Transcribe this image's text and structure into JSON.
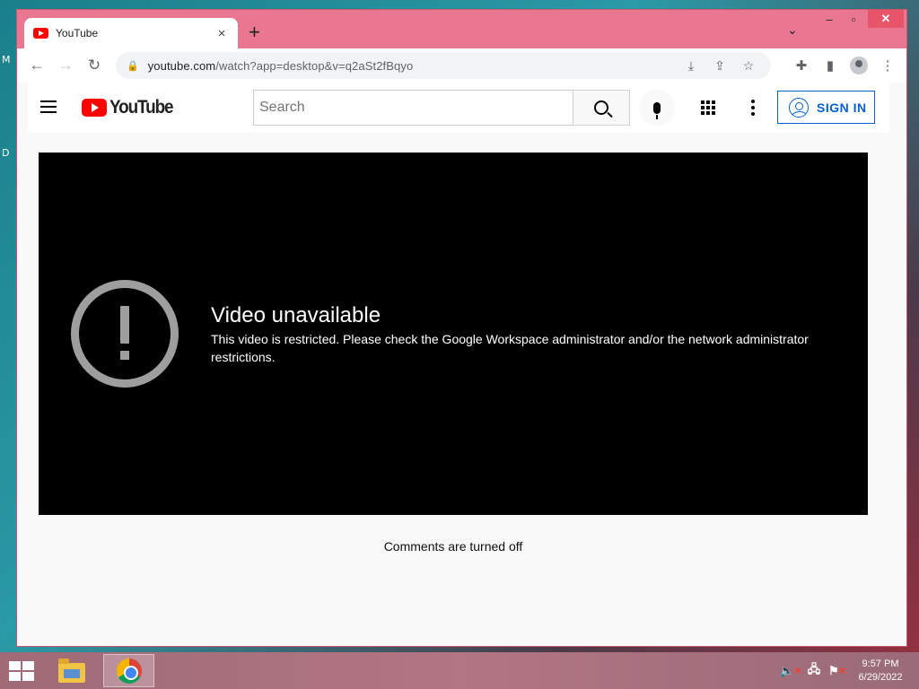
{
  "desktop": {
    "edge_letter_1": "M",
    "edge_letter_2": "D"
  },
  "browser": {
    "tab": {
      "title": "YouTube",
      "close": "×"
    },
    "new_tab": "+",
    "tab_search": "⌄",
    "window_controls": {
      "minimize": "–",
      "maximize": "▫",
      "close": "✕"
    },
    "toolbar": {
      "back": "←",
      "forward": "→",
      "reload": "↻",
      "url_host": "youtube.com",
      "url_path": "/watch?app=desktop&v=q2aSt2fBqyo",
      "install_icon": "⤓",
      "share_icon": "⇪",
      "star_icon": "☆",
      "extensions_icon": "✚",
      "sidepanel_icon": "▮",
      "menu_icon": "⋮"
    }
  },
  "youtube": {
    "logo_text": "YouTube",
    "search": {
      "placeholder": "Search"
    },
    "sign_in_label": "SIGN IN",
    "error": {
      "title": "Video unavailable",
      "message": "This video is restricted. Please check the Google Workspace administrator and/or the network administrator restrictions."
    },
    "comments_status": "Comments are turned off"
  },
  "taskbar": {
    "time": "9:57 PM",
    "date": "6/29/2022",
    "tray": [
      "🔈",
      "🖧",
      "⚑"
    ]
  },
  "colors": {
    "window_frame": "#ea7791",
    "youtube_red": "#ff0000",
    "signin_blue": "#065fd4",
    "player_bg": "#000000"
  }
}
